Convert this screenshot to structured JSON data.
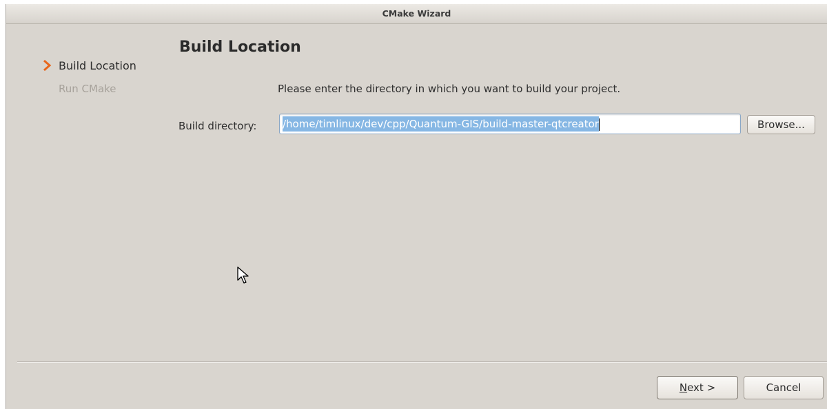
{
  "window": {
    "title": "CMake Wizard"
  },
  "sidebar": {
    "steps": [
      {
        "label": "Build Location",
        "state": "current"
      },
      {
        "label": "Run CMake",
        "state": "pending"
      }
    ],
    "current_step_icon": "chevron-right-icon"
  },
  "page": {
    "title": "Build Location",
    "instruction": "Please enter the directory in which you want to build your project."
  },
  "build_directory": {
    "label": "Build directory:",
    "value": "/home/timlinux/dev/cpp/Quantum-GIS/build-master-qtcreator",
    "selected": true
  },
  "buttons": {
    "browse": "Browse...",
    "next_mnemonic": "N",
    "next_rest": "ext >",
    "cancel": "Cancel"
  },
  "colors": {
    "accent_orange": "#e8661b",
    "selection_blue": "#86b7e4",
    "window_bg": "#d9d5cf"
  },
  "icons": {
    "cursor": "mouse-pointer-icon"
  }
}
